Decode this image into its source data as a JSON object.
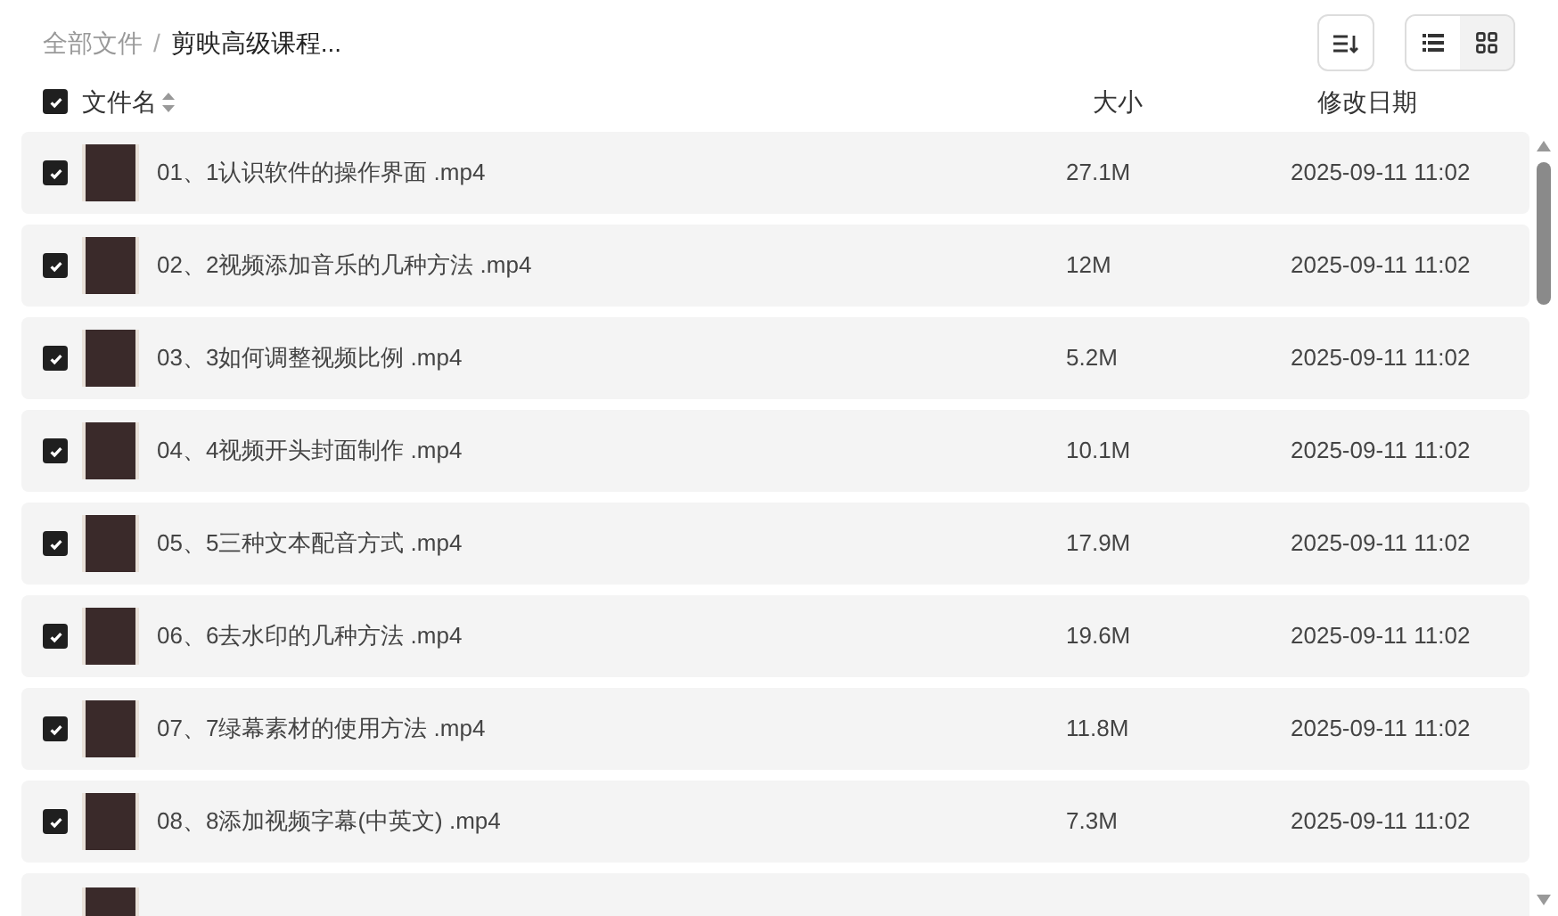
{
  "breadcrumb_separator": "/",
  "breadcrumb": [
    {
      "label": "全部文件",
      "current": false
    },
    {
      "label": "剪映高级课程...",
      "current": true
    }
  ],
  "view_modes": [
    {
      "kind": "list",
      "selected": true
    },
    {
      "kind": "grid",
      "selected": false
    }
  ],
  "header": {
    "checked": true,
    "name": "文件名",
    "size": "大小",
    "date": "修改日期"
  },
  "rows": [
    {
      "checked": true,
      "name": "01、1认识软件的操作界面 .mp4",
      "size": "27.1M",
      "date": "2025-09-11 11:02"
    },
    {
      "checked": true,
      "name": "02、2视频添加音乐的几种方法 .mp4",
      "size": "12M",
      "date": "2025-09-11 11:02"
    },
    {
      "checked": true,
      "name": "03、3如何调整视频比例 .mp4",
      "size": "5.2M",
      "date": "2025-09-11 11:02"
    },
    {
      "checked": true,
      "name": "04、4视频开头封面制作 .mp4",
      "size": "10.1M",
      "date": "2025-09-11 11:02"
    },
    {
      "checked": true,
      "name": "05、5三种文本配音方式 .mp4",
      "size": "17.9M",
      "date": "2025-09-11 11:02"
    },
    {
      "checked": true,
      "name": "06、6去水印的几种方法 .mp4",
      "size": "19.6M",
      "date": "2025-09-11 11:02"
    },
    {
      "checked": true,
      "name": "07、7绿幕素材的使用方法 .mp4",
      "size": "11.8M",
      "date": "2025-09-11 11:02"
    },
    {
      "checked": true,
      "name": "08、8添加视频字幕(中英文) .mp4",
      "size": "7.3M",
      "date": "2025-09-11 11:02"
    }
  ]
}
